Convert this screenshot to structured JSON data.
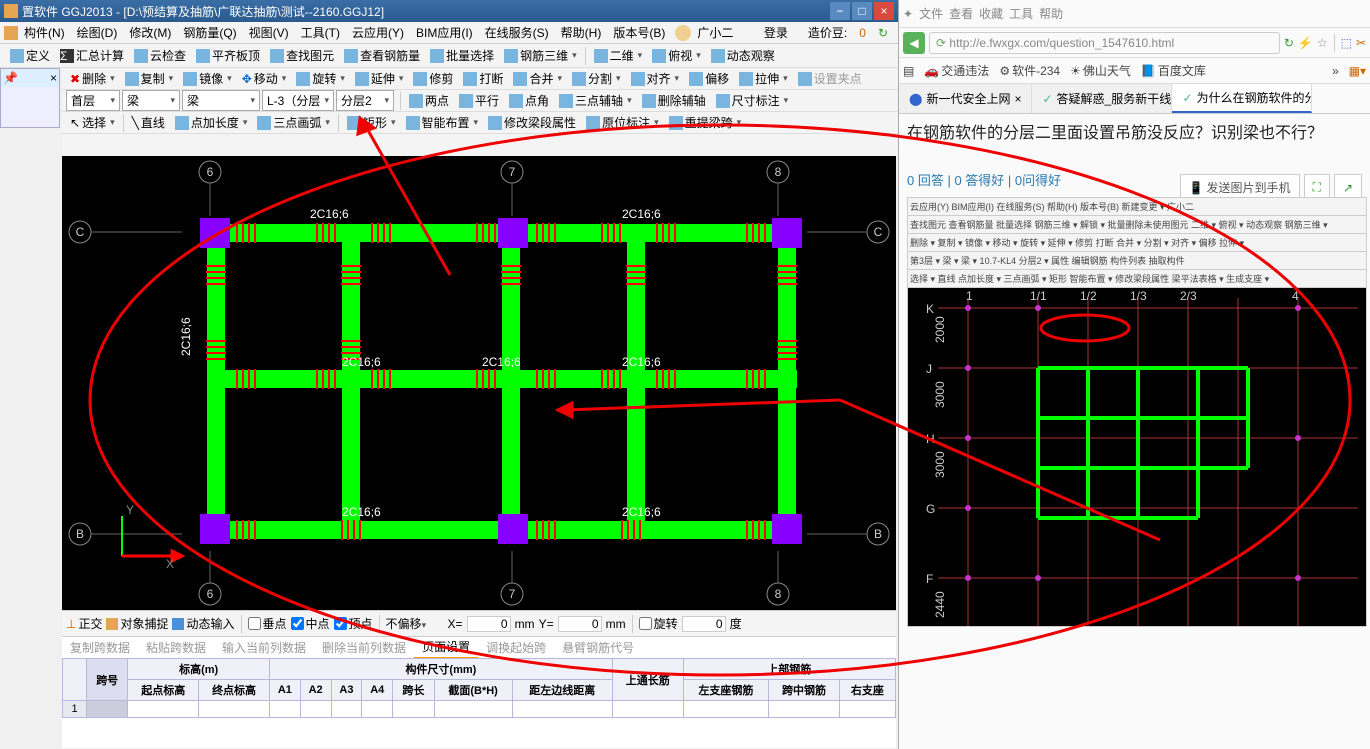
{
  "app": {
    "title": "置软件 GGJ2013 - [D:\\预结算及抽筋\\广联达抽筋\\测试--2160.GGJ12]",
    "menus": [
      "构件(N)",
      "绘图(D)",
      "修改(M)",
      "钢筋量(Q)",
      "视图(V)",
      "工具(T)",
      "云应用(Y)",
      "BIM应用(I)",
      "在线服务(S)",
      "帮助(H)",
      "版本号(B)"
    ],
    "user": "广小二",
    "login": "登录",
    "coins_label": "造价豆:",
    "coins": "0"
  },
  "tb1": {
    "define": "定义",
    "sum": "汇总计算",
    "cloud": "云检查",
    "flat": "平齐板顶",
    "find": "查找图元",
    "rebar": "查看钢筋量",
    "batch": "批量选择",
    "rebar3d": "钢筋三维",
    "2d": "二维",
    "over": "俯视",
    "dyn": "动态观察"
  },
  "tb2": {
    "del": "删除",
    "copy": "复制",
    "mirror": "镜像",
    "move": "移动",
    "rotate": "旋转",
    "extend": "延伸",
    "trim": "修剪",
    "break": "打断",
    "merge": "合并",
    "split": "分割",
    "align": "对齐",
    "offset": "偏移",
    "stretch": "拉伸",
    "point": "设置夹点"
  },
  "cb": {
    "floor": "首层",
    "type1": "梁",
    "type2": "梁",
    "layer": "L-3（分层",
    "sub": "分层2",
    "sel": "选择",
    "line": "直线",
    "ptlen": "点加长度",
    "arc3": "三点画弧",
    "rect": "矩形",
    "smart": "智能布置",
    "modbeam": "修改梁段属性",
    "inplace": "原位标注",
    "rehang": "重提梁跨",
    "two": "两点",
    "para": "平行",
    "ptang": "点角",
    "aux3": "三点辅轴",
    "delaux": "删除辅轴",
    "dim": "尺寸标注"
  },
  "snap": {
    "ortho": "正交",
    "obj": "对象捕捉",
    "dyn": "动态输入",
    "perp": "垂点",
    "mid": "中点",
    "top": "顶点",
    "nooff": "不偏移",
    "x": "X=",
    "y": "Y=",
    "mm": "mm",
    "rot": "旋转",
    "deg": "度",
    "xv": "0",
    "yv": "0",
    "rv": "0"
  },
  "btabs": {
    "copy": "复制跨数据",
    "paste": "粘贴跨数据",
    "input": "输入当前列数据",
    "del": "删除当前列数据",
    "page": "页面设置",
    "adj": "调换起始跨",
    "cant": "悬臂钢筋代号"
  },
  "table": {
    "h1": "跨号",
    "h2": "标高(m)",
    "h3": "构件尺寸(mm)",
    "h4": "上通长筋",
    "h5": "上部钢筋",
    "s1": "起点标高",
    "s2": "终点标高",
    "s3": "A1",
    "s4": "A2",
    "s5": "A3",
    "s6": "A4",
    "s7": "跨长",
    "s8": "截面(B*H)",
    "s9": "距左边线距离",
    "s10": "左支座钢筋",
    "s11": "跨中钢筋",
    "s12": "右支座",
    "row": "1"
  },
  "canvas": {
    "axes_top": [
      "6",
      "7",
      "8"
    ],
    "axes_bot": [
      "6",
      "7",
      "8"
    ],
    "axes_left": [
      "C",
      "B"
    ],
    "axes_right": [
      "C",
      "B"
    ],
    "labels": [
      "2C16;6",
      "2C16;6",
      "2C16;6",
      "2C16;6",
      "2C16;6",
      "2C16;6",
      "2C16;6",
      "2C16;6"
    ]
  },
  "browser": {
    "topmenu": [
      "文件",
      "查看",
      "收藏",
      "工具",
      "帮助"
    ],
    "url": "http://e.fwxgx.com/question_1547610.html",
    "fav": [
      {
        "i": "🚗",
        "t": "交通违法"
      },
      {
        "i": "⚙",
        "t": "软件-234"
      },
      {
        "i": "☀",
        "t": "佛山天气"
      },
      {
        "i": "📘",
        "t": "百度文库"
      }
    ],
    "tabs": [
      {
        "t": "新一代安全上网",
        "act": false
      },
      {
        "t": "答疑解惑_服务新干线|广",
        "act": false
      },
      {
        "t": "为什么在钢筋软件的分层",
        "act": true
      }
    ],
    "question": "在钢筋软件的分层二里面设置吊筋没反应？识别梁也不行？",
    "stats": "0 回答 | 0 答得好 | 0问得好",
    "send": "发送图片到手机"
  },
  "qimg": {
    "menus": "云应用(Y) BIM应用(I) 在线服务(S) 帮助(H) 版本号(B) 新建变更 ▾ 广小二",
    "tb": "查找图元 查看钢筋量 批量选择 钢筋三维 ▾ 解锁 ▾ 批量删除未使用图元 二维 ▾ 俯视 ▾ 动态观察 钢筋三维 ▾",
    "tb2": "删除 ▾ 复制 ▾ 镜像 ▾ 移动 ▾ 旋转 ▾ 延伸 ▾ 修剪 打断 合并 ▾ 分割 ▾ 对齐 ▾ 偏移 拉伸 ▾",
    "cb": "第3层 ▾ 梁 ▾ 梁 ▾ 10.7-KL4 分层2 ▾ 属性 编辑钢筋 构件列表 抽取构件",
    "sel": "选择 ▾ 直线 点加长度 ▾ 三点画弧 ▾ 矩形 智能布置 ▾ 修改梁段属性 梁平法表格 ▾ 生成支座 ▾",
    "axY": [
      "K",
      "J",
      "H",
      "G",
      "F"
    ],
    "dims": [
      "2000",
      "3000",
      "3000",
      "2440"
    ],
    "axX": [
      "1",
      "1/1",
      "1/2",
      "1/3",
      "2/3",
      "4"
    ]
  }
}
